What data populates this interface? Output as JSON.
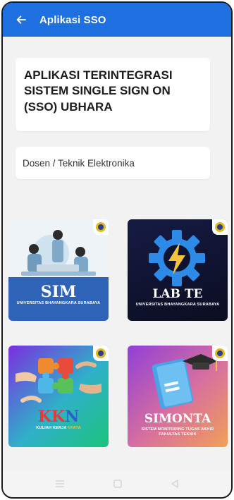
{
  "appbar": {
    "title": "Aplikasi SSO",
    "back_icon": "arrow-left-icon",
    "color": "#1e6fe0"
  },
  "header_card": {
    "title": "APLIKASI TERINTEGRASI SISTEM SINGLE SIGN ON (SSO) UBHARA"
  },
  "role_card": {
    "text": "Dosen / Teknik Elektronika"
  },
  "apps": [
    {
      "name": "SIM",
      "sub": "UNIVERSITAS BHAYANGKARA SURABAYA"
    },
    {
      "name": "LAB TE",
      "sub": "UNIVERSITAS BHAYANGKARA SURABAYA"
    },
    {
      "name_part1": "KK",
      "name_part2": "N",
      "sub_part1": "KULIAH KERJA ",
      "sub_part2": "NYATA"
    },
    {
      "name": "SIMONTA",
      "sub": "SISTEM MONITORING TUGAS AKHIR FAKULTAS TEKNIK"
    }
  ],
  "navbar": {
    "icons": [
      "menu-icon",
      "square-icon",
      "back-triangle-icon"
    ]
  }
}
